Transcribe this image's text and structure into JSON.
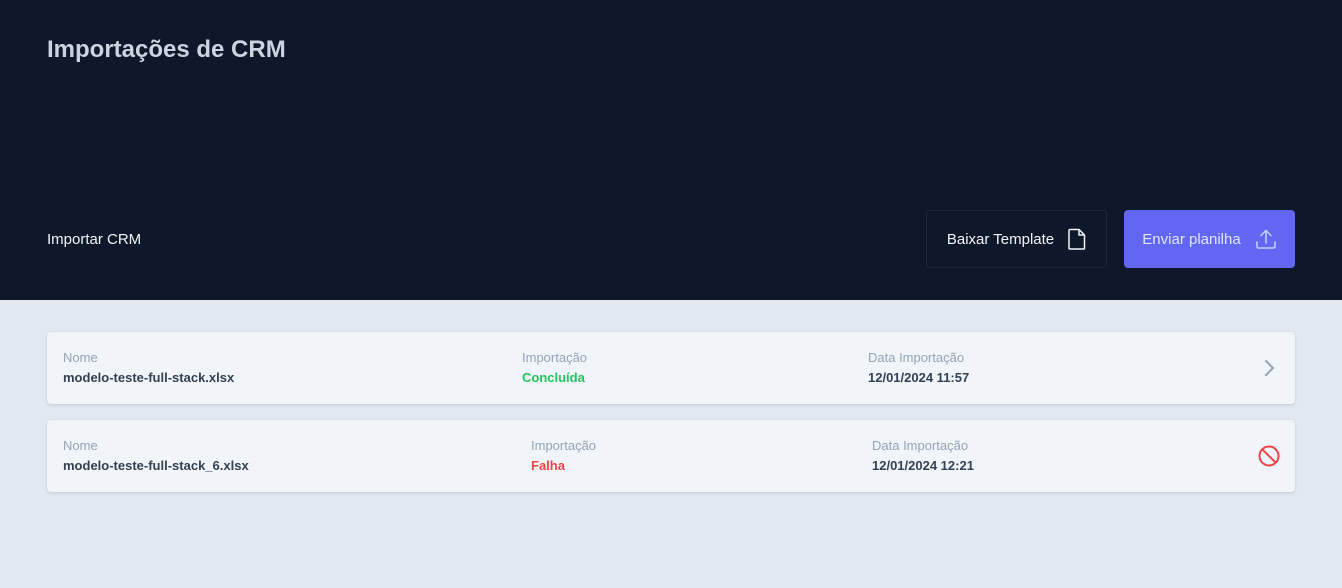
{
  "header": {
    "title": "Importações de CRM",
    "section_label": "Importar CRM",
    "download_button_label": "Baixar Template",
    "upload_button_label": "Enviar planilha"
  },
  "imports": [
    {
      "name_label": "Nome",
      "name": "modelo-teste-full-stack.xlsx",
      "status_label": "Importação",
      "status": "Concluída",
      "date_label": "Data Importação",
      "date": "12/01/2024 11:57",
      "action_icon": "chevron-right-icon"
    },
    {
      "name_label": "Nome",
      "name": "modelo-teste-full-stack_6.xlsx",
      "status_label": "Importação",
      "status": "Falha",
      "date_label": "Data Importação",
      "date": "12/01/2024 12:21",
      "action_icon": "blocked-icon"
    }
  ],
  "colors": {
    "header_bg": "#0f172a",
    "page_bg": "#e2e8f0",
    "primary": "#6366f1",
    "success": "#22c55e",
    "error": "#ef4444"
  }
}
